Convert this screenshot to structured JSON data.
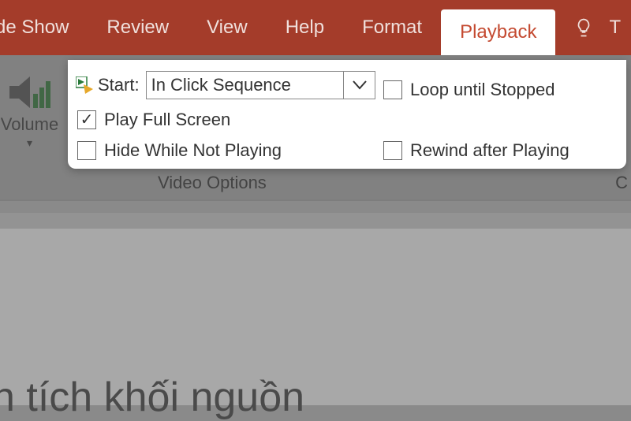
{
  "tabs": {
    "items": [
      "de Show",
      "Review",
      "View",
      "Help",
      "Format",
      "Playback"
    ],
    "activeIndex": 5,
    "rightCutoff": "T"
  },
  "ribbon": {
    "volume_label": "Volume",
    "group_label": "Video Options",
    "right_group_label_cut": "C"
  },
  "options": {
    "start_label": "Start:",
    "start_value": "In Click Sequence",
    "play_full_screen": {
      "label": "Play Full Screen",
      "checked": true
    },
    "hide_while_not_playing": {
      "label": "Hide While Not Playing",
      "checked": false
    },
    "loop_until_stopped": {
      "label": "Loop until Stopped",
      "checked": false
    },
    "rewind_after_playing": {
      "label": "Rewind after Playing",
      "checked": false
    }
  },
  "slide": {
    "partial_text": "n tích khối nguồn"
  }
}
